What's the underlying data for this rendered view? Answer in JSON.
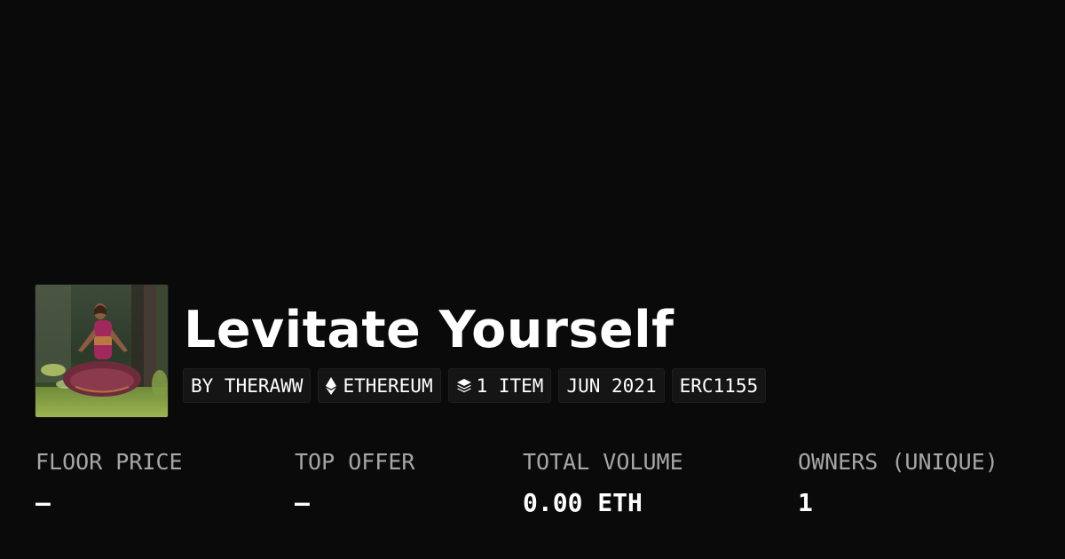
{
  "collection": {
    "title": "Levitate Yourself",
    "thumbnail_icon": "collection-thumbnail"
  },
  "tags": {
    "creator": "BY THERAWW",
    "chain": "ETHEREUM",
    "chain_icon": "ethereum-icon",
    "items": "1 ITEM",
    "items_icon": "layers-icon",
    "date": "JUN 2021",
    "standard": "ERC1155"
  },
  "stats": {
    "floor_price": {
      "label": "FLOOR PRICE",
      "value": "—"
    },
    "top_offer": {
      "label": "TOP OFFER",
      "value": "—"
    },
    "total_volume": {
      "label": "TOTAL VOLUME",
      "value": "0.00 ETH"
    },
    "owners": {
      "label": "OWNERS (UNIQUE)",
      "value": "1"
    }
  },
  "colors": {
    "background": "#0a0a0a",
    "tag_background": "#151515",
    "label_gray": "#a6a6a6",
    "text_white": "#ffffff"
  }
}
